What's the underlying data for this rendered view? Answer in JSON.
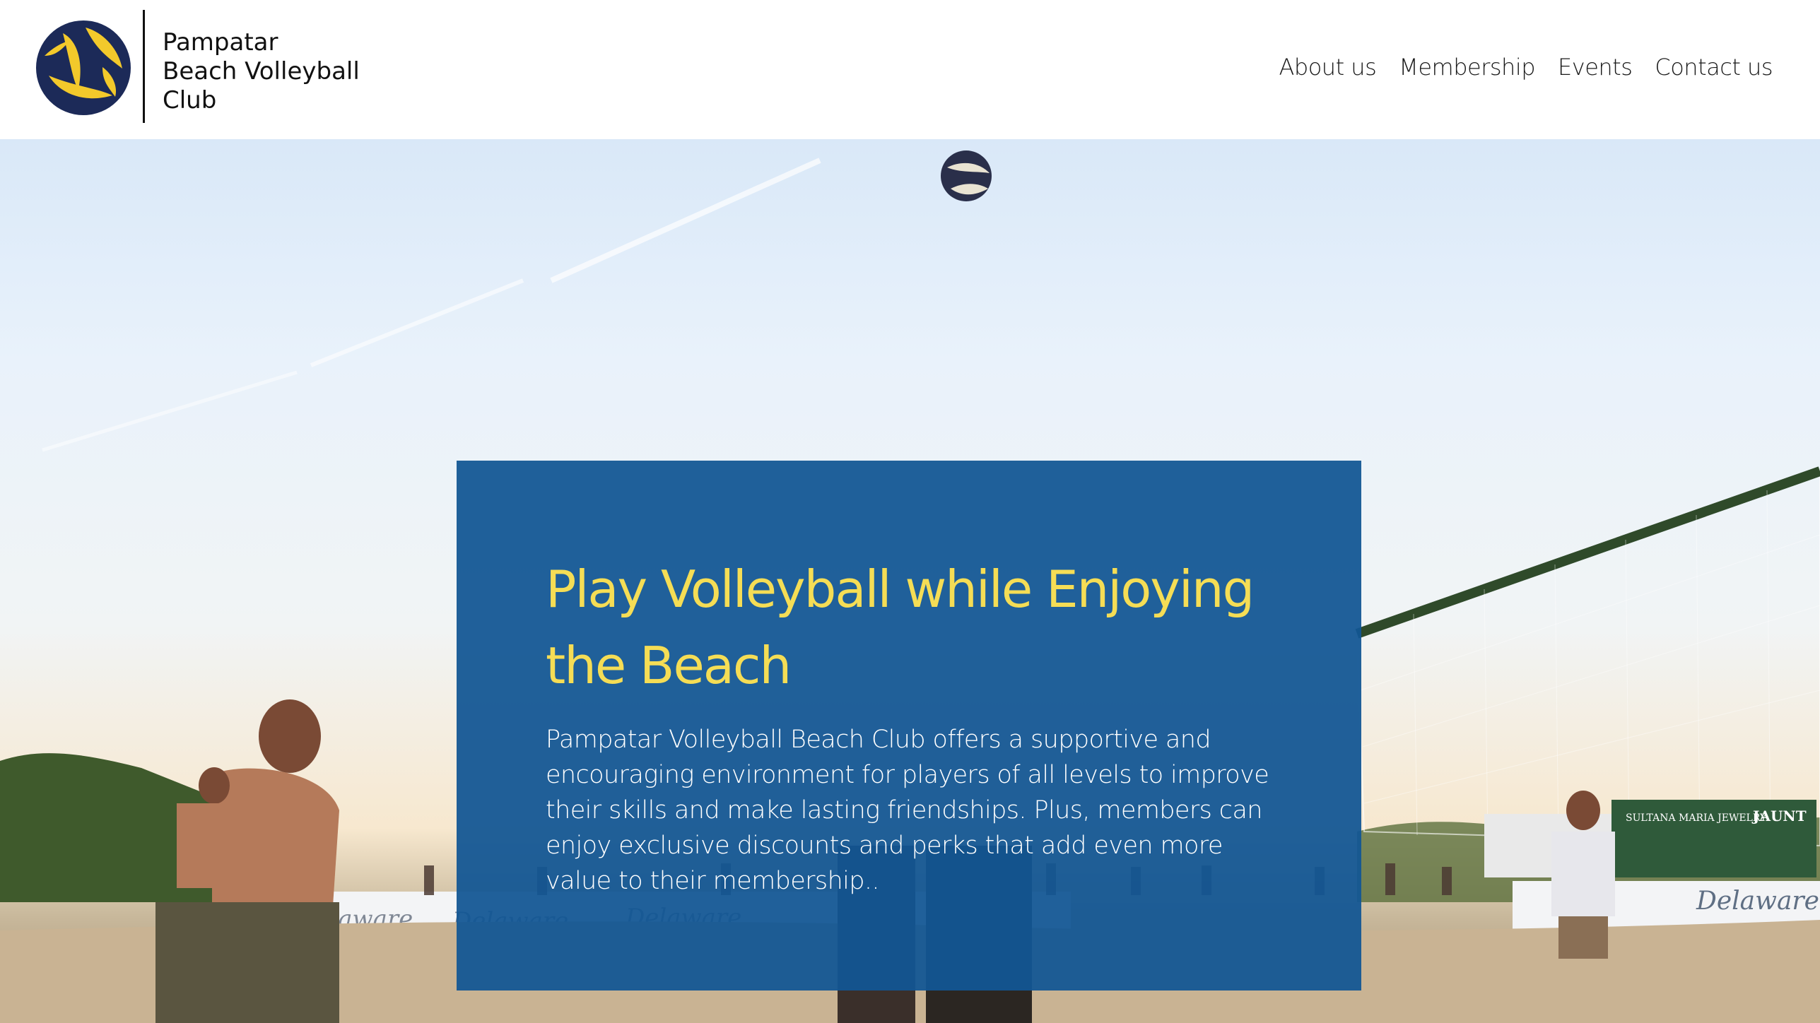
{
  "header": {
    "brand_name": "Pampatar\nBeach Volleyball\nClub",
    "nav": [
      {
        "label": "About us"
      },
      {
        "label": "Membership"
      },
      {
        "label": "Events"
      },
      {
        "label": "Contact us"
      }
    ]
  },
  "hero": {
    "title": "Play Volleyball while  Enjoying the  Beach",
    "body": "Pampatar Volleyball  Beach Club offers a supportive and encouraging environment for players of all levels to improve their skills and make lasting friendships.  Plus, members can enjoy exclusive discounts and perks that add even more value to their membership..",
    "banner_text": "Delaware",
    "tent_signs": [
      "SULTANA MARIA JEWELRY",
      "JAUNT"
    ]
  },
  "colors": {
    "card_bg": "#125694",
    "title": "#f5dd55",
    "body_text": "#ffffff",
    "logo_yellow": "#f3c92b",
    "logo_navy": "#1c2a58"
  },
  "icons": {
    "logo": "volleyball-logo-icon",
    "ball": "volleyball-icon"
  }
}
